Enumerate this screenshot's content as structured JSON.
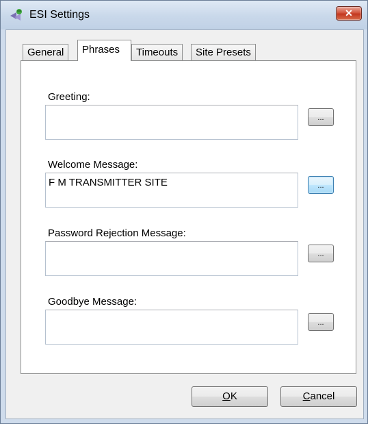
{
  "window": {
    "title": "ESI Settings",
    "close_glyph": "✕"
  },
  "tabs": [
    {
      "label": "General",
      "active": false
    },
    {
      "label": "Phrases",
      "active": true
    },
    {
      "label": "Timeouts",
      "active": false
    },
    {
      "label": "Site Presets",
      "active": false
    }
  ],
  "fields": {
    "greeting": {
      "label": "Greeting:",
      "value": ""
    },
    "welcome": {
      "label": "Welcome Message:",
      "value": "F M TRANSMITTER SITE"
    },
    "password_rejection": {
      "label": "Password Rejection Message:",
      "value": ""
    },
    "goodbye": {
      "label": "Goodbye Message:",
      "value": ""
    }
  },
  "browse_button_label": "...",
  "buttons": {
    "ok": {
      "label_underlined": "O",
      "label_rest": "K"
    },
    "cancel": {
      "label_underlined": "C",
      "label_rest": "ancel"
    }
  },
  "colors": {
    "title_bar": "#c9d8ea",
    "close_button": "#c3371f",
    "focus_border": "#3c7fb1"
  }
}
